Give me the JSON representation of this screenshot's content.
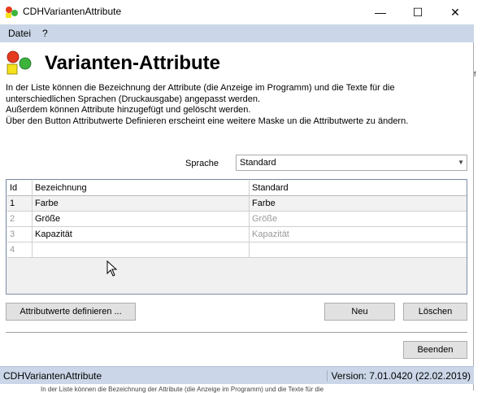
{
  "window": {
    "title": "CDHVariantenAttribute",
    "minimize_glyph": "—",
    "maximize_glyph": "☐",
    "close_glyph": "✕"
  },
  "menu": {
    "items": [
      {
        "label": "Datei"
      },
      {
        "label": "?"
      }
    ]
  },
  "header": {
    "title": "Varianten-Attribute",
    "icon": "shapes-logo-icon",
    "description": [
      "In der Liste können die Bezeichnung der Attribute (die Anzeige im Programm) und die Texte für die",
      "unterschiedlichen Sprachen (Druckausgabe) angepasst werden.",
      "Außerdem können Attribute hinzugefügt und gelöscht werden.",
      "Über den Button Attributwerte Definieren erscheint eine weitere Maske un die Attributwerte zu ändern."
    ]
  },
  "language": {
    "label": "Sprache",
    "selected": "Standard"
  },
  "grid": {
    "columns": [
      "Id",
      "Bezeichnung",
      "Standard"
    ],
    "rows": [
      {
        "id": "1",
        "bezeichnung": "Farbe",
        "standard": "Farbe"
      },
      {
        "id": "2",
        "bezeichnung": "Größe",
        "standard": "Größe"
      },
      {
        "id": "3",
        "bezeichnung": "Kapazität",
        "standard": "Kapazität"
      },
      {
        "id": "4",
        "bezeichnung": "",
        "standard": ""
      }
    ]
  },
  "buttons": {
    "define_values": "Attributwerte definieren ...",
    "new": "Neu",
    "delete": "Löschen",
    "close": "Beenden"
  },
  "status": {
    "app_name": "CDHVariantenAttribute",
    "version": "Version: 7.01.0420 (22.02.2019)"
  },
  "background": {
    "bottom_text": "In der Liste können die Bezeichnung der Attribute (die Anzeige im Programm) und die Texte für die",
    "edge_text": "f"
  },
  "colors": {
    "menubar": "#cbd7e8",
    "statusbar": "#cbd7e8",
    "button_face": "#e1e1e1",
    "grid_border": "#7a8fa8"
  }
}
